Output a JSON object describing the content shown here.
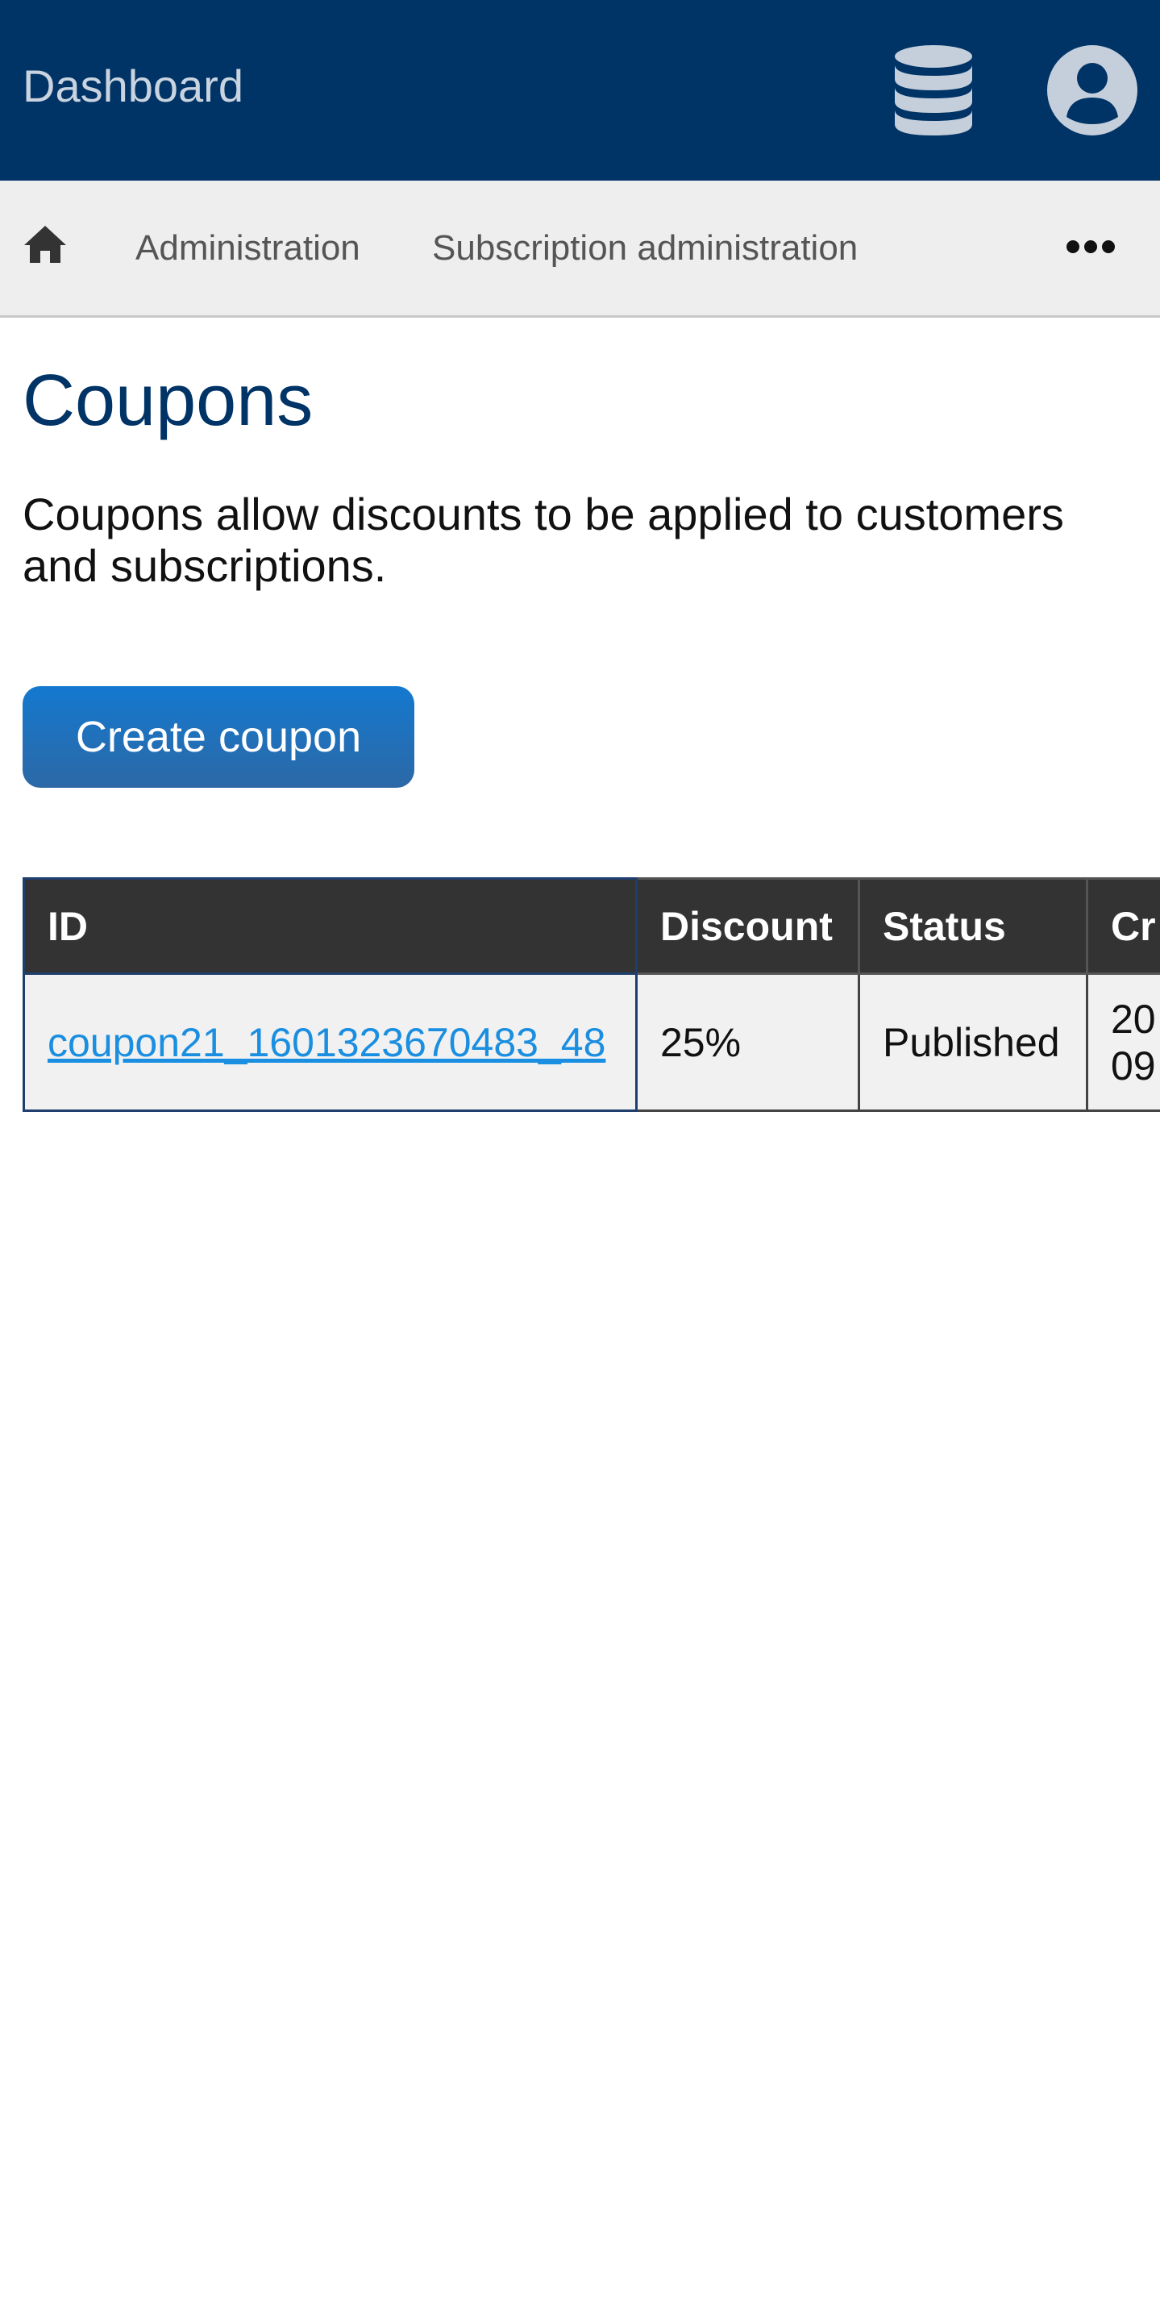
{
  "header": {
    "brand": "Dashboard",
    "icons": [
      "database-icon",
      "account-icon"
    ]
  },
  "breadcrumb": {
    "home_icon": "home-icon",
    "items": [
      {
        "label": "Administration"
      },
      {
        "label": "Subscription administration"
      }
    ],
    "more_icon": "more-horizontal-icon"
  },
  "main": {
    "title": "Coupons",
    "intro": "Coupons allow discounts to be applied to customers and subscriptions.",
    "create_label": "Create coupon"
  },
  "table": {
    "columns": [
      "ID",
      "Discount",
      "Status",
      "Cr"
    ],
    "rows": [
      {
        "id": "coupon21_1601323670483_48",
        "discount": "25%",
        "status": "Published",
        "created_line1": "20",
        "created_line2": "09"
      }
    ]
  },
  "colors": {
    "header_bg": "#003366",
    "breadcrumb_bg": "#eeeeee",
    "title": "#003366",
    "button": "#1479cf",
    "table_header_bg": "#333333",
    "link": "#1a8ee0"
  }
}
